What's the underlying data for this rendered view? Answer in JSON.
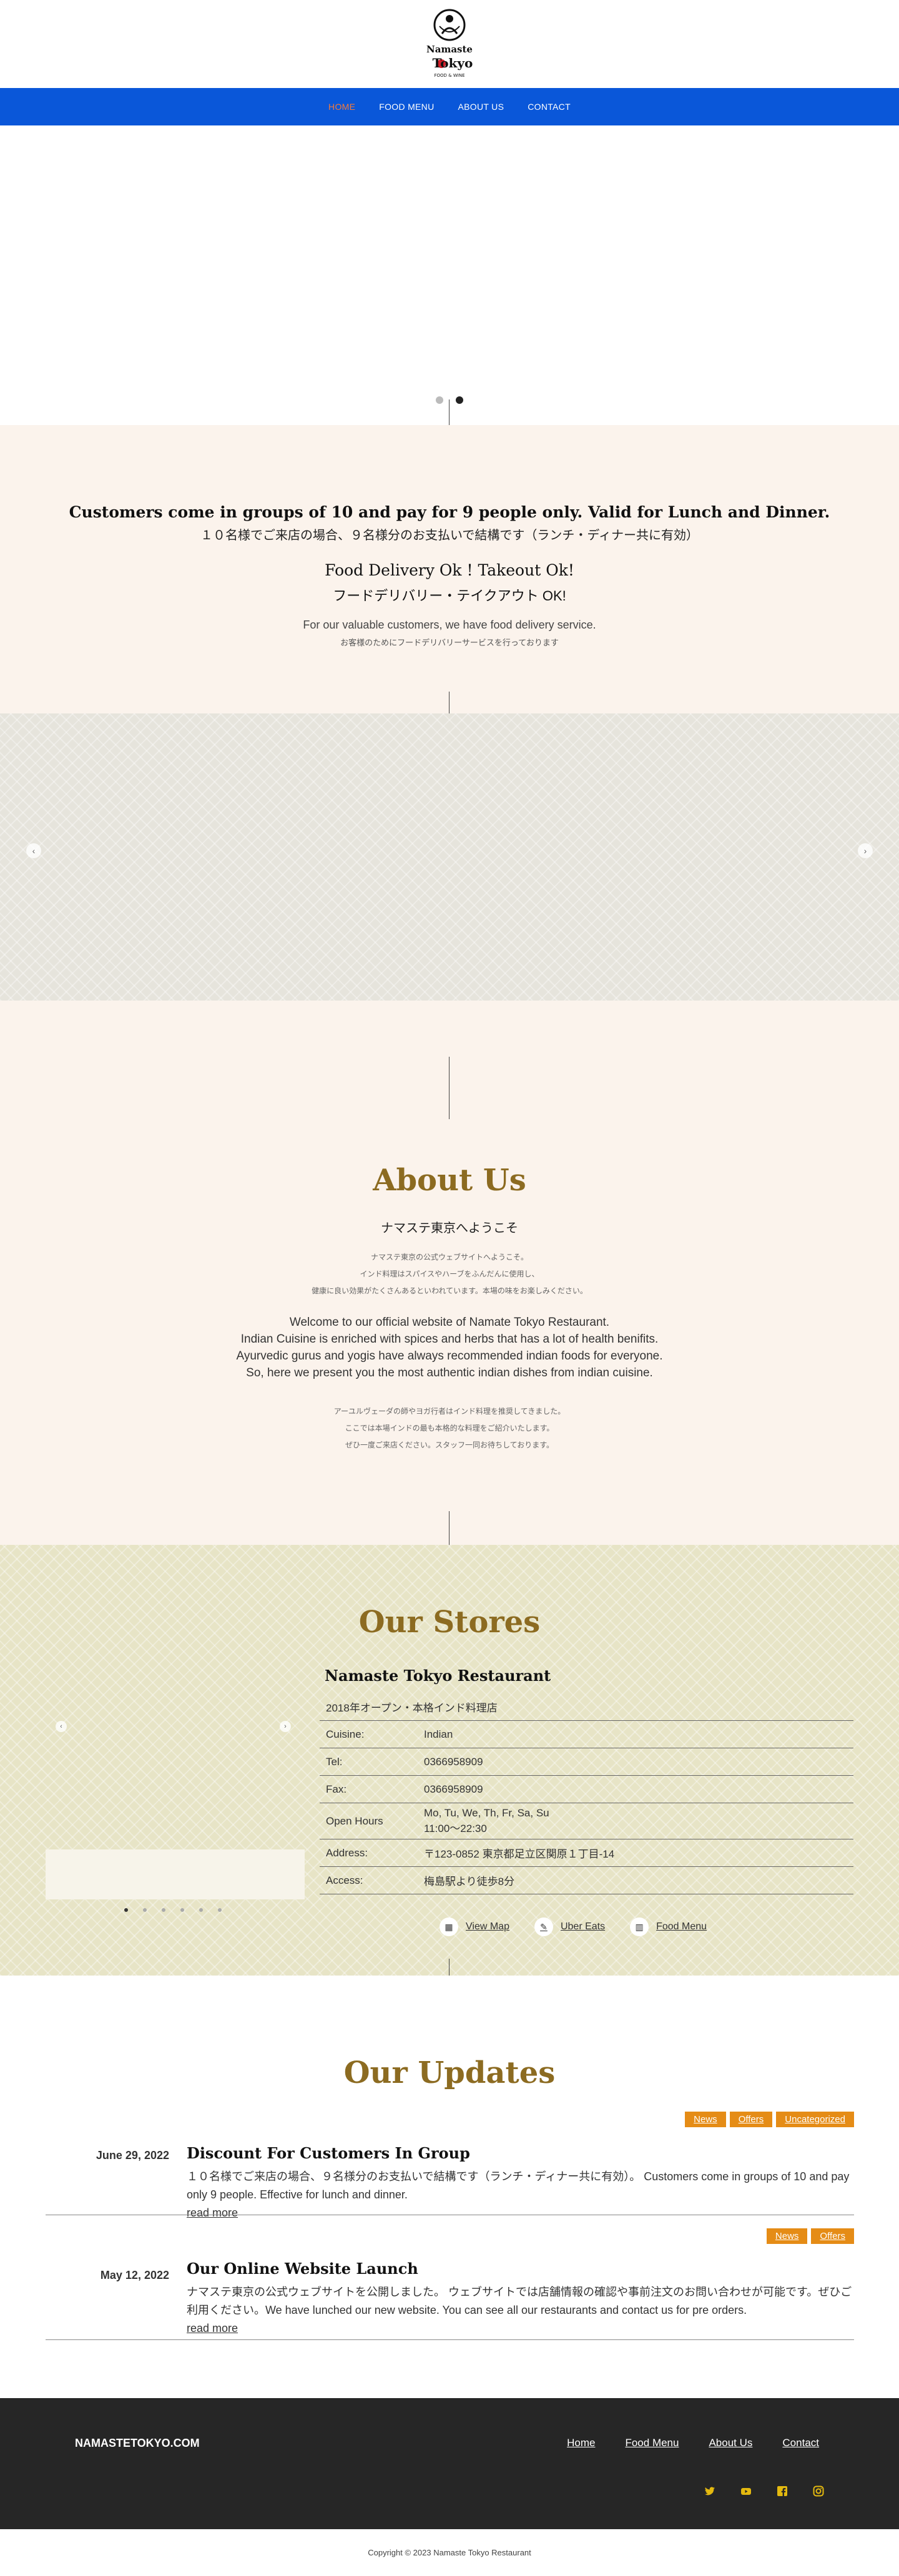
{
  "header": {
    "logo_line1": "Namaste",
    "logo_line2": "Tokyo",
    "logo_tag": "FOOD & WINE"
  },
  "nav": [
    {
      "label": "HOME"
    },
    {
      "label": "FOOD MENU"
    },
    {
      "label": "ABOUT US"
    },
    {
      "label": "CONTACT"
    }
  ],
  "promo": {
    "line1": "Customers come in groups of 10 and pay for 9 people only. Valid for Lunch and Dinner.",
    "line2": "１０名様でご来店の場合、９名様分のお支払いで結構です（ランチ・ディナー共に有効）",
    "line3": "Food Delivery Ok ! Takeout Ok!",
    "line4": "フードデリバリー・テイクアウト OK!",
    "line5": "For our valuable customers, we have food delivery service.",
    "line6": "お客様のためにフードデリバリーサービスを行っております"
  },
  "about": {
    "title": "About Us",
    "subtitle": "ナマステ東京へようこそ",
    "jp1": [
      "ナマステ東京の公式ウェブサイトへようこそ。",
      "インド料理はスパイスやハーブをふんだんに使用し、",
      "健康に良い効果がたくさんあるといわれています。本場の味をお楽しみください。"
    ],
    "en": [
      "Welcome to our official website of Namate Tokyo Restaurant.",
      "Indian Cuisine is enriched with spices and herbs that has a lot of health benifits.",
      "Ayurvedic gurus and yogis have always recommended indian foods for everyone.",
      "So, here we present you the most authentic indian dishes from indian cuisine."
    ],
    "jp2": [
      "アーユルヴェーダの師やヨガ行者はインド料理を推奨してきました。",
      "ここでは本場インドの最も本格的な料理をご紹介いたします。",
      "ぜひ一度ご来店ください。スタッフ一同お待ちしております。"
    ]
  },
  "stores": {
    "title": "Our Stores",
    "name": "Namaste Tokyo Restaurant",
    "note": "2018年オープン・本格インド料理店",
    "rows": [
      {
        "k": "Cuisine:",
        "v": "Indian"
      },
      {
        "k": "Tel:",
        "v": "0366958909"
      },
      {
        "k": "Fax:",
        "v": "0366958909"
      },
      {
        "k": "Open Hours",
        "v": "Mo, Tu, We, Th, Fr, Sa, Su",
        "v2": "11:00〜22:30"
      },
      {
        "k": "Address:",
        "v": "〒123-0852 東京都足立区関原１丁目-14"
      },
      {
        "k": "Access:",
        "v": "梅島駅より徒歩8分"
      }
    ],
    "links": [
      {
        "label": "View Map",
        "icon": "map-icon"
      },
      {
        "label": "Uber Eats",
        "icon": "pen-icon"
      },
      {
        "label": "Food Menu",
        "icon": "book-icon"
      }
    ]
  },
  "updates": {
    "title": "Our Updates",
    "posts": [
      {
        "date": "June 29, 2022",
        "title": "Discount For Customers In Group",
        "tags": [
          "News",
          "Offers",
          "Uncategorized"
        ],
        "excerpt": "１０名様でご来店の場合、９名様分のお支払いで結構です（ランチ・ディナー共に有効）。 Customers come in groups of 10 and pay only 9 people. Effective for lunch and dinner.",
        "more": "read more"
      },
      {
        "date": "May 12, 2022",
        "title": "Our Online Website Launch",
        "tags": [
          "News",
          "Offers"
        ],
        "excerpt": "ナマステ東京の公式ウェブサイトを公開しました。 ウェブサイトでは店舗情報の確認や事前注文のお問い合わせが可能です。ぜひご利用ください。We have lunched our new website. You can see all our restaurants and contact us for pre orders.",
        "more": "read more"
      }
    ]
  },
  "footer": {
    "brand": "NAMASTETOKYO.COM",
    "links": [
      "Home",
      "Food Menu",
      "About Us",
      "Contact"
    ],
    "social": [
      "twitter-icon",
      "youtube-icon",
      "facebook-icon",
      "instagram-icon"
    ],
    "copyright": "Copyright © 2023 Namaste Tokyo Restaurant"
  },
  "colors": {
    "nav": "#0a57d9",
    "nav_active": "#f47a3b",
    "gold": "#8c6b21",
    "tag": "#e58c16",
    "footer": "#262626",
    "social": "#e4b90f"
  }
}
